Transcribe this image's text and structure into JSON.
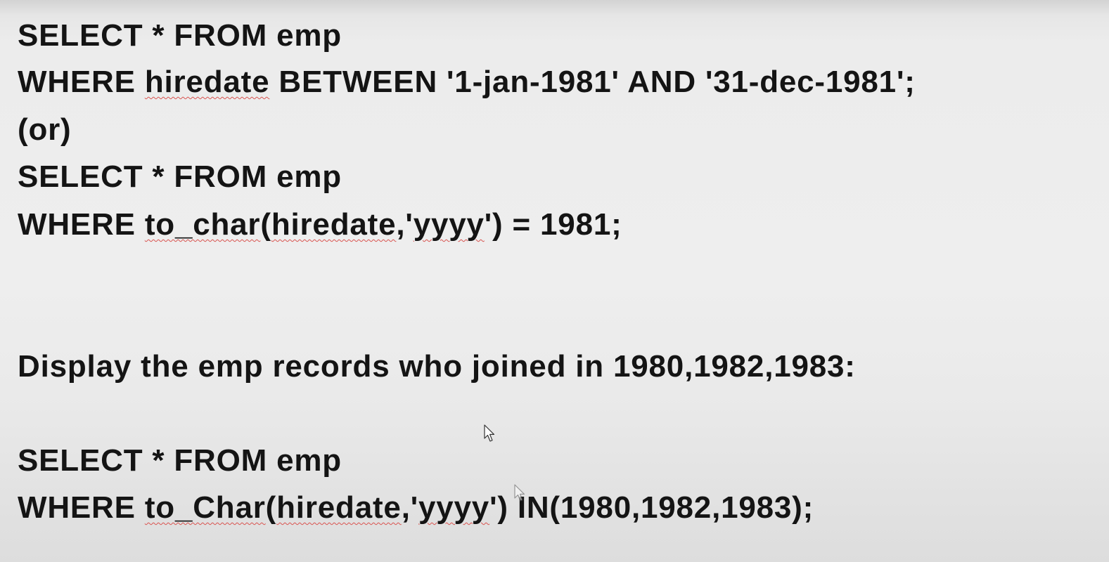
{
  "document": {
    "block1": {
      "line1": "SELECT * FROM emp",
      "line2": {
        "t1": "WHERE ",
        "t2": "hiredate",
        "t3": " BETWEEN '1-jan-1981' AND '31-dec-1981';"
      }
    },
    "separator": "(or)",
    "block2": {
      "line1": "SELECT * FROM emp",
      "line2": {
        "t1": "WHERE ",
        "t2": "to_char",
        "t3": "(",
        "t4": "hiredate",
        "t5": ",'",
        "t6": "yyyy",
        "t7": "') = 1981;"
      }
    },
    "question": "Display the emp records who joined in 1980,1982,1983:",
    "block3": {
      "line1": "SELECT * FROM emp",
      "line2": {
        "t1": "WHERE ",
        "t2": "to_Char",
        "t3": "(",
        "t4": "hiredate",
        "t5": ",'",
        "t6": "yyyy",
        "t7": "') IN(1980,1982,1983);"
      }
    }
  },
  "colors": {
    "text": "#141414",
    "spellcheck_underline": "#d9534f",
    "background": "#eeeeee"
  },
  "icons": [
    "mouse-pointer-icon"
  ]
}
